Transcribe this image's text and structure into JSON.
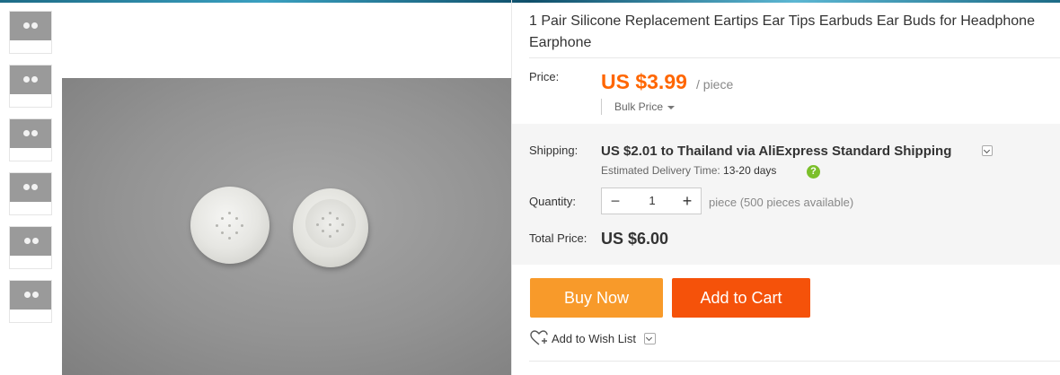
{
  "product": {
    "title": "1 Pair Silicone Replacement Eartips Ear Tips Earbuds Ear Buds for Headphone Earphone"
  },
  "price": {
    "label": "Price:",
    "value": "US $3.99",
    "unit": "/ piece",
    "bulk_label": "Bulk Price"
  },
  "shipping": {
    "label": "Shipping:",
    "text": "US $2.01 to Thailand via AliExpress Standard Shipping",
    "delivery_label": "Estimated Delivery Time:",
    "delivery_value": "13-20 days",
    "help_glyph": "?"
  },
  "quantity": {
    "label": "Quantity:",
    "minus": "−",
    "value": "1",
    "plus": "+",
    "availability": "piece (500 pieces available)"
  },
  "total": {
    "label": "Total Price:",
    "value": "US $6.00"
  },
  "actions": {
    "buy_now": "Buy Now",
    "add_to_cart": "Add to Cart",
    "wishlist": "Add to Wish List"
  },
  "colors": {
    "price": "#ff6600",
    "buy_now": "#f89a2a",
    "add_to_cart": "#f5520a",
    "help_icon": "#7bbf2a"
  },
  "icons": [
    "help-icon",
    "heart-icon",
    "chevron-down-icon"
  ]
}
